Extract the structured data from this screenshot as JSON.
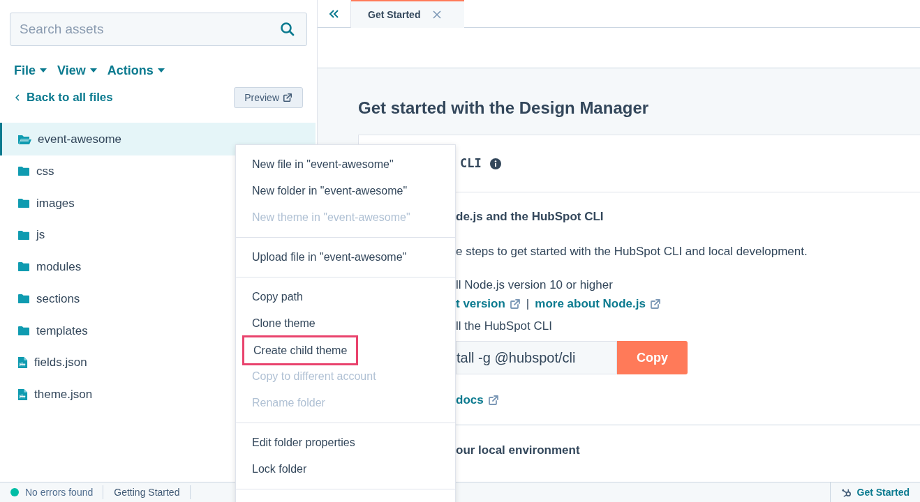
{
  "sidebar": {
    "search": {
      "placeholder": "Search assets"
    },
    "menus": [
      "File",
      "View",
      "Actions"
    ],
    "back_link": "Back to all files",
    "preview_button": "Preview",
    "tree": [
      {
        "name": "event-awesome",
        "kind": "folder",
        "selected": true,
        "expanded": true,
        "children": [
          {
            "name": "css",
            "kind": "folder",
            "selected": false
          },
          {
            "name": "images",
            "kind": "folder",
            "selected": false
          },
          {
            "name": "js",
            "kind": "folder",
            "selected": false
          },
          {
            "name": "modules",
            "kind": "folder",
            "selected": false
          },
          {
            "name": "sections",
            "kind": "folder",
            "selected": false
          },
          {
            "name": "templates",
            "kind": "folder",
            "selected": false
          },
          {
            "name": "fields.json",
            "kind": "file",
            "selected": false
          },
          {
            "name": "theme.json",
            "kind": "file",
            "selected": false
          }
        ]
      }
    ]
  },
  "tabs": [
    {
      "label": "Get Started",
      "selected": true
    }
  ],
  "main": {
    "heading": "Get started with the Design Manager",
    "card": {
      "title": "CLI",
      "step_title": "de.js and the HubSpot CLI",
      "intro": "e steps to get started with the HubSpot CLI and local development.",
      "step_1": "ll Node.js version 10 or higher",
      "links": [
        "t version",
        "more about Node.js"
      ],
      "separator": "|",
      "step_2": "ll the HubSpot CLI",
      "command": "tall -g @hubspot/cli",
      "copy_button": "Copy",
      "docs_link": "docs",
      "next_section": "our local environment"
    }
  },
  "context_menu": {
    "groups": [
      [
        {
          "label": "New file in \"event-awesome\"",
          "disabled": false,
          "highlighted": false
        },
        {
          "label": "New folder in \"event-awesome\"",
          "disabled": false,
          "highlighted": false
        },
        {
          "label": "New theme in \"event-awesome\"",
          "disabled": true,
          "highlighted": false
        }
      ],
      [
        {
          "label": "Upload file in \"event-awesome\"",
          "disabled": false,
          "highlighted": false
        }
      ],
      [
        {
          "label": "Copy path",
          "disabled": false,
          "highlighted": false
        },
        {
          "label": "Clone theme",
          "disabled": false,
          "highlighted": false
        },
        {
          "label": "Create child theme",
          "disabled": false,
          "highlighted": true
        },
        {
          "label": "Copy to different account",
          "disabled": true,
          "highlighted": false
        },
        {
          "label": "Rename folder",
          "disabled": true,
          "highlighted": false
        }
      ],
      [
        {
          "label": "Edit folder properties",
          "disabled": false,
          "highlighted": false
        },
        {
          "label": "Lock folder",
          "disabled": false,
          "highlighted": false
        }
      ]
    ]
  },
  "status_bar": {
    "status": "No errors found",
    "item": "Getting Started",
    "help_button": "Get Started"
  }
}
